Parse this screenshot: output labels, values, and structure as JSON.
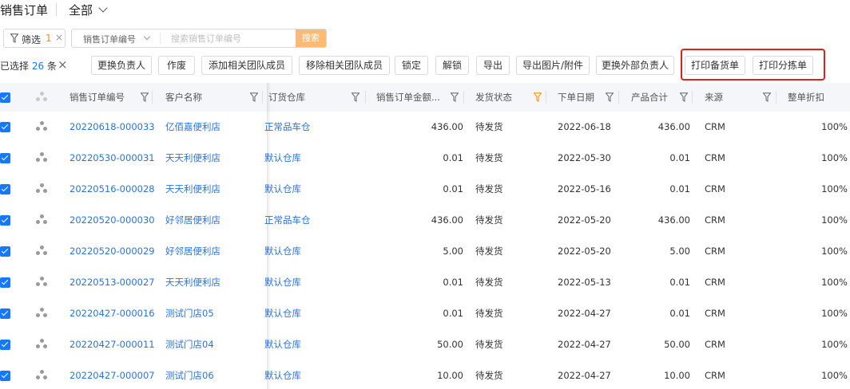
{
  "header": {
    "title": "销售订单",
    "view_label": "全部"
  },
  "filter_bar": {
    "filter_label": "筛选",
    "filter_count": "1",
    "clear_symbol": "×",
    "search_field": "销售订单编号",
    "search_placeholder": "搜索销售订单编号",
    "search_button": "搜索"
  },
  "toolbar": {
    "selected_prefix": "已选择",
    "selected_count": "26",
    "selected_suffix": "条",
    "buttons": [
      "更换负责人",
      "作废",
      "添加相关团队成员",
      "移除相关团队成员",
      "锁定",
      "解锁",
      "导出",
      "导出图片/附件",
      "更换外部负责人",
      "打印备货单",
      "打印分拣单"
    ]
  },
  "table": {
    "columns": [
      "销售订单编号",
      "客户名称",
      "订货仓库",
      "销售订单金额...",
      "发货状态",
      "下单日期",
      "产品合计",
      "来源",
      "整单折扣"
    ],
    "active_filter_column": "发货状态",
    "rows": [
      {
        "order_no": "20220618-000033",
        "customer": "亿佰嘉便利店",
        "warehouse": "正常品车仓",
        "amount": "436.00",
        "status": "待发货",
        "date": "2022-06-18",
        "total": "436.00",
        "source": "CRM",
        "discount": "100%"
      },
      {
        "order_no": "20220530-000031",
        "customer": "天天利便利店",
        "warehouse": "默认仓库",
        "amount": "0.01",
        "status": "待发货",
        "date": "2022-05-30",
        "total": "0.01",
        "source": "CRM",
        "discount": "100%"
      },
      {
        "order_no": "20220516-000028",
        "customer": "天天利便利店",
        "warehouse": "默认仓库",
        "amount": "0.01",
        "status": "待发货",
        "date": "2022-05-16",
        "total": "0.01",
        "source": "CRM",
        "discount": "100%"
      },
      {
        "order_no": "20220520-000030",
        "customer": "好邻居便利店",
        "warehouse": "正常品车仓",
        "amount": "436.00",
        "status": "待发货",
        "date": "2022-05-20",
        "total": "436.00",
        "source": "CRM",
        "discount": "100%"
      },
      {
        "order_no": "20220520-000029",
        "customer": "好邻居便利店",
        "warehouse": "默认仓库",
        "amount": "5.00",
        "status": "待发货",
        "date": "2022-05-20",
        "total": "5.00",
        "source": "CRM",
        "discount": "100%"
      },
      {
        "order_no": "20220513-000027",
        "customer": "天天利便利店",
        "warehouse": "默认仓库",
        "amount": "0.01",
        "status": "待发货",
        "date": "2022-05-13",
        "total": "0.01",
        "source": "CRM",
        "discount": "100%"
      },
      {
        "order_no": "20220427-000016",
        "customer": "测试门店05",
        "warehouse": "默认仓库",
        "amount": "0.01",
        "status": "待发货",
        "date": "2022-04-27",
        "total": "0.01",
        "source": "CRM",
        "discount": "100%"
      },
      {
        "order_no": "20220427-000011",
        "customer": "测试门店04",
        "warehouse": "默认仓库",
        "amount": "50.00",
        "status": "待发货",
        "date": "2022-04-27",
        "total": "50.00",
        "source": "CRM",
        "discount": "100%"
      },
      {
        "order_no": "20220427-000007",
        "customer": "测试门店06",
        "warehouse": "默认仓库",
        "amount": "10.00",
        "status": "待发货",
        "date": "2022-04-27",
        "total": "10.00",
        "source": "CRM",
        "discount": "100%"
      }
    ]
  },
  "colors": {
    "accent": "#1677ff",
    "link": "#2b73d8",
    "filter_active": "#ff8a00",
    "search_button": "#ffbb73",
    "highlight_box": "#e0211a"
  }
}
